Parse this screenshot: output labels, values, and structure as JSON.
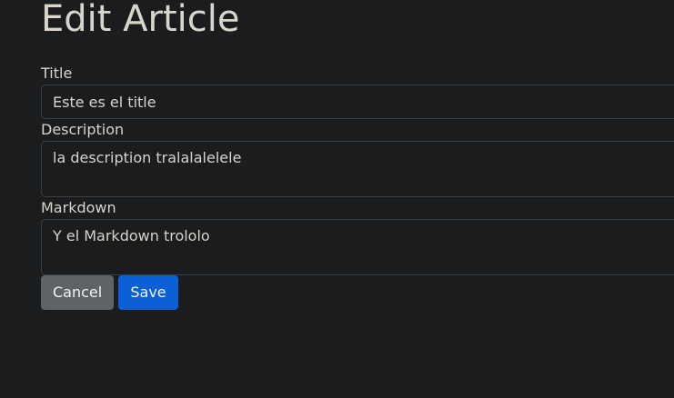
{
  "page": {
    "heading": "Edit Article"
  },
  "form": {
    "title": {
      "label": "Title",
      "value": "Este es el title"
    },
    "description": {
      "label": "Description",
      "value": "la description tralalalelele"
    },
    "markdown": {
      "label": "Markdown",
      "value": "Y el Markdown trololo"
    }
  },
  "actions": {
    "cancel_label": "Cancel",
    "save_label": "Save"
  },
  "colors": {
    "background": "#1b1c1e",
    "cancel_button": "#5e6368",
    "save_button": "#0c5fd4"
  }
}
